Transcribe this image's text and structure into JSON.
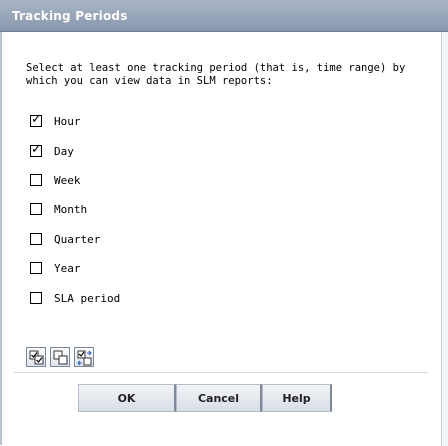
{
  "dialog": {
    "title": "Tracking Periods",
    "instructions": "Select at least one tracking period (that is, time range) by which you can view data in SLM reports:"
  },
  "periods": [
    {
      "label": "Hour",
      "checked": true
    },
    {
      "label": "Day",
      "checked": true
    },
    {
      "label": "Week",
      "checked": false
    },
    {
      "label": "Month",
      "checked": false
    },
    {
      "label": "Quarter",
      "checked": false
    },
    {
      "label": "Year",
      "checked": false
    },
    {
      "label": "SLA period",
      "checked": false
    }
  ],
  "toolbar": {
    "icons": [
      "select-all-icon",
      "clear-all-icon",
      "invert-selection-icon"
    ]
  },
  "buttons": {
    "ok": "OK",
    "cancel": "Cancel",
    "help": "Help"
  },
  "colors": {
    "titlebar": "#98a4b9",
    "title_text": "#ffffff",
    "button_face": "#e4e8ee"
  }
}
